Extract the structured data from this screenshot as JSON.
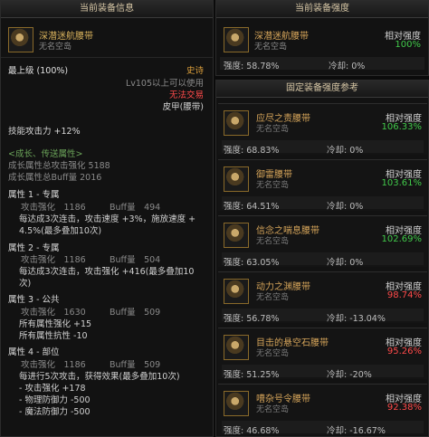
{
  "left": {
    "header": "当前装备信息",
    "item_name": "深潜迷航腰带",
    "item_sub": "无名空岛",
    "grade": "最上级 (100%)",
    "rarity": "史诗",
    "level": "Lv105以上可以使用",
    "trade": "无法交易",
    "type": "皮甲(腰带)",
    "skill_atk": "技能攻击力 +12%",
    "growth_header": "<成长、传送属性>",
    "growth_atk": "成长属性总攻击强化 5188",
    "growth_buff": "成长属性总Buff量 2016",
    "attrs": [
      {
        "title": "属性 1 - 专属",
        "atk": "攻击强化　1186",
        "buff": "Buff量　494",
        "lines": [
          "每达成3次连击，攻击速度 +3%，施放速度 +",
          "4.5%(最多叠加10次)"
        ]
      },
      {
        "title": "属性 2 - 专属",
        "atk": "攻击强化　1186",
        "buff": "Buff量　504",
        "lines": [
          "每达成3次连击，攻击强化 +416(最多叠加10",
          "次)"
        ]
      },
      {
        "title": "属性 3 - 公共",
        "atk": "攻击强化　1630",
        "buff": "Buff量　509",
        "lines": [
          "所有属性强化 +15",
          "所有属性抗性 -10"
        ]
      },
      {
        "title": "属性 4 - 部位",
        "atk": "攻击强化　1186",
        "buff": "Buff量　509",
        "lines": [
          "每进行5次攻击，获得效果(最多叠加10次)",
          "- 攻击强化 +178",
          "- 物理防御力 -500",
          "- 魔法防御力 -500"
        ]
      }
    ]
  },
  "right_top": {
    "header": "当前装备强度",
    "item_name": "深潜迷航腰带",
    "item_sub": "无名空岛",
    "rel_label": "相对强度",
    "rel_value": "100%",
    "strength": "强度: 58.78%",
    "cooldown": "冷却: 0%"
  },
  "ref_header": "固定装备强度参考",
  "refs": [
    {
      "name": "应尽之责腰带",
      "sub": "无名空岛",
      "rel": "相对强度",
      "pct": "106.33%",
      "color": "#41c94a",
      "strength": "强度: 68.83%",
      "cooldown": "冷却: 0%"
    },
    {
      "name": "御雷腰带",
      "sub": "无名空岛",
      "rel": "相对强度",
      "pct": "103.61%",
      "color": "#41c94a",
      "strength": "强度: 64.51%",
      "cooldown": "冷却: 0%"
    },
    {
      "name": "信念之喘息腰带",
      "sub": "无名空岛",
      "rel": "相对强度",
      "pct": "102.69%",
      "color": "#41c94a",
      "strength": "强度: 63.05%",
      "cooldown": "冷却: 0%"
    },
    {
      "name": "动力之渊腰带",
      "sub": "无名空岛",
      "rel": "相对强度",
      "pct": "98.74%",
      "color": "#ff4a4a",
      "strength": "强度: 56.78%",
      "cooldown": "冷却: -13.04%"
    },
    {
      "name": "目击的悬空石腰带",
      "sub": "无名空岛",
      "rel": "相对强度",
      "pct": "95.26%",
      "color": "#ff4a4a",
      "strength": "强度: 51.25%",
      "cooldown": "冷却: -20%"
    },
    {
      "name": "嘈杂号令腰带",
      "sub": "无名空岛",
      "rel": "相对强度",
      "pct": "92.38%",
      "color": "#ff4a4a",
      "strength": "强度: 46.68%",
      "cooldown": "冷却: -16.67%"
    }
  ]
}
